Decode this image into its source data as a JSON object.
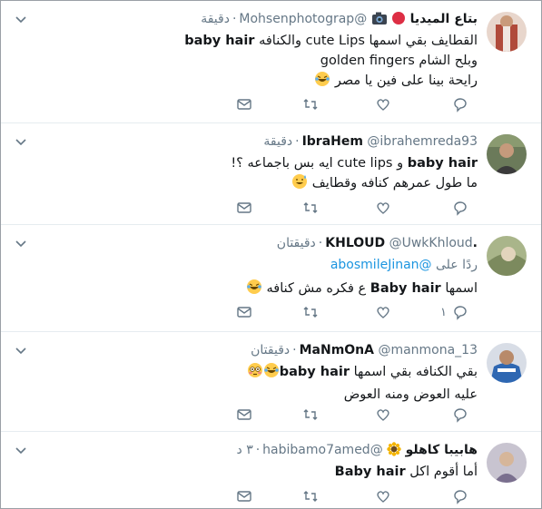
{
  "tweets": [
    {
      "name": "بتاع الميديا",
      "handle": "@Mohsenphotograp",
      "time": "دقيقة",
      "lines": [
        [
          "القطايف بقي اسمها ",
          "cute Lips",
          " والكنافه ",
          "baby hair"
        ],
        [
          "وبلح الشام ",
          "golden fingers",
          "",
          ""
        ],
        [
          "رايحة بينا على فين يا مصر",
          "",
          "",
          ""
        ]
      ],
      "reply_count": "",
      "colors": {
        "avatar_bg": "#b04a3a",
        "avatar_fg": "#f0d0c0"
      }
    },
    {
      "name": "IbraHem",
      "handle": "@ibrahemreda93",
      "time": "دقيقة",
      "lines": [
        [
          "baby hair",
          " و cute lips ايه بس باجماعه ؟!",
          "",
          ""
        ],
        [
          "ما طول عمرهم كنافه وقطايف",
          "",
          "",
          ""
        ]
      ],
      "reply_count": "",
      "colors": {
        "avatar_bg": "#5a6a4a",
        "avatar_fg": "#d9c8a0"
      }
    },
    {
      "name": ".KHLOUD",
      "handle": "@UwkKhloud",
      "time": "دقيقتان",
      "replying_label": "ردًا على",
      "replying_to": "@abosmileJinan",
      "lines": [
        [
          "اسمها ",
          "Baby hair",
          " ع فكره مش كنافه",
          ""
        ]
      ],
      "reply_count": "١",
      "colors": {
        "avatar_bg": "#9aa77a",
        "avatar_fg": "#e6e0c8"
      }
    },
    {
      "name": "MaNmOnA",
      "handle": "@manmona_13",
      "time": "دقيقتان",
      "lines": [
        [
          "بقي الكنافه بقي اسمها ",
          "baby hair",
          "",
          ""
        ],
        [
          "عليه العوض ومنه العوض",
          "",
          "",
          ""
        ]
      ],
      "reply_count": "",
      "colors": {
        "avatar_bg": "#4a7ab8",
        "avatar_fg": "#f2f2f2"
      }
    },
    {
      "name": "هابيبا كاهلو",
      "handle": "@habibamo7amed",
      "time": "٣ د",
      "lines": [
        [
          "أما أقوم اكل ",
          "Baby hair",
          "",
          ""
        ]
      ],
      "reply_count": "",
      "colors": {
        "avatar_bg": "#8a8aa0",
        "avatar_fg": "#e0d8e8"
      }
    }
  ],
  "icons": {
    "reply": "reply-icon",
    "retweet": "retweet-icon",
    "like": "like-icon",
    "dm": "message-icon",
    "menu": "chevron-down-icon"
  },
  "colors": {
    "muted": "#657786",
    "link": "#1b95e0",
    "divider": "#e6ecf0"
  }
}
